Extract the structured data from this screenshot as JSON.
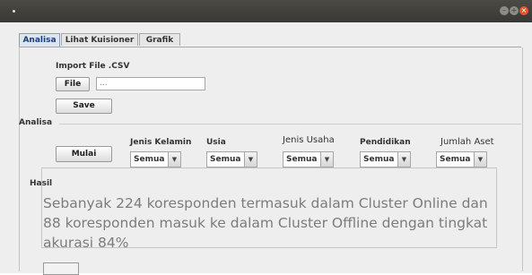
{
  "tabs": [
    "Analisa",
    "Lihat Kuisioner",
    "Grafik"
  ],
  "import": {
    "label": "Import File .CSV",
    "file_button": "File",
    "path_value": "...",
    "save_button": "Save"
  },
  "analysis": {
    "section_label": "Analisa",
    "start_button": "Mulai",
    "filters": [
      {
        "label": "Jenis Kelamin",
        "value": "Semua"
      },
      {
        "label": "Usia",
        "value": "Semua"
      },
      {
        "label": "Jenis Usaha",
        "value": "Semua"
      },
      {
        "label": "Pendidikan",
        "value": "Semua"
      },
      {
        "label": "Jumlah Aset",
        "value": "Semua"
      }
    ]
  },
  "result": {
    "label": "Hasil",
    "text": "Sebanyak 224 koresponden termasuk dalam Cluster Online dan 88 koresponden masuk ke dalam Cluster Offline dengan tingkat akurasi 84%"
  },
  "colors": {
    "titlebar": "#3e3d39",
    "close_button": "#e2582a",
    "tab_active": "#1b3f73"
  }
}
